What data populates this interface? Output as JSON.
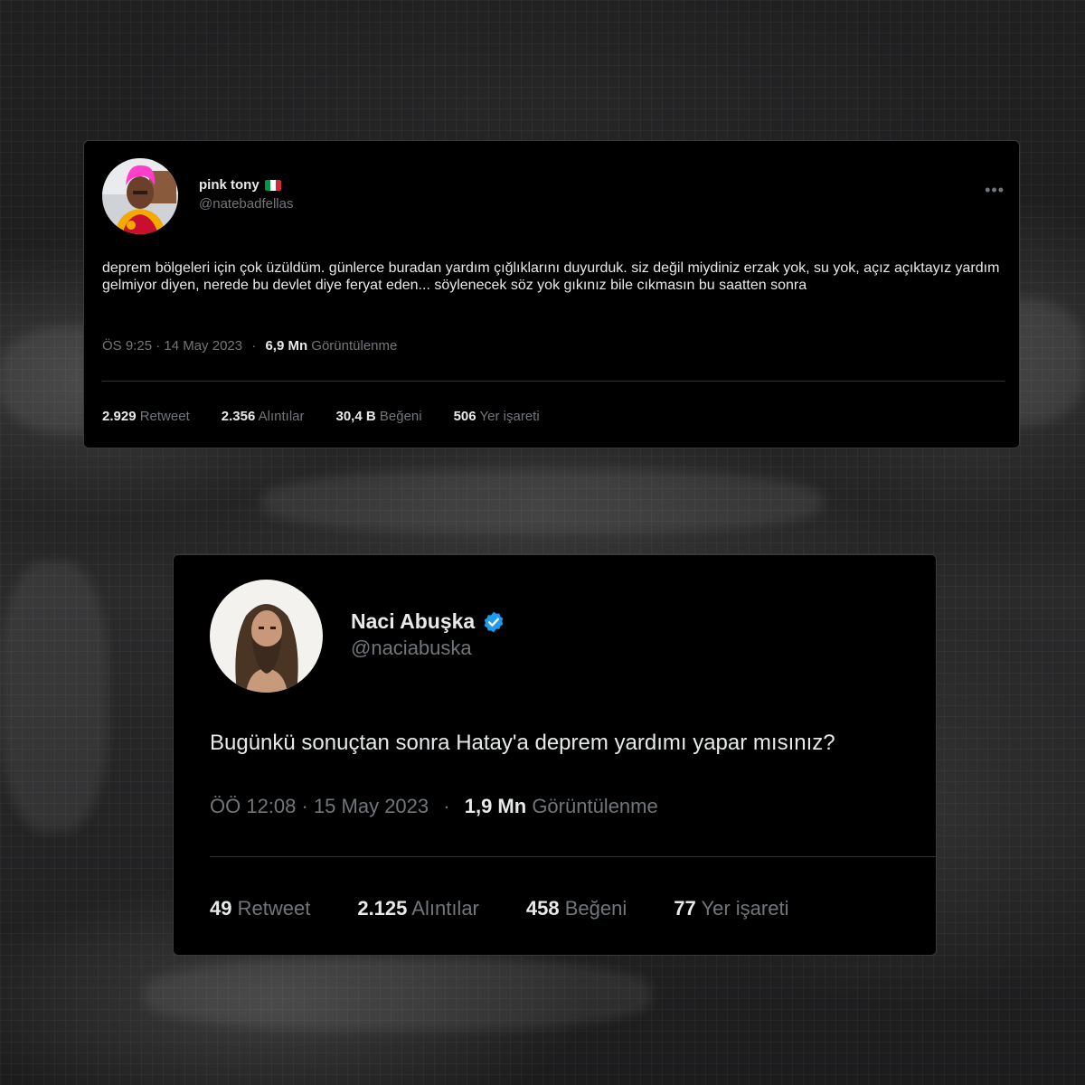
{
  "tweets": [
    {
      "display_name": "pink tony",
      "flag_icon": "italy-flag-icon",
      "handle": "@natebadfellas",
      "more_icon": "more-options-icon",
      "text": "deprem bölgeleri için çok üzüldüm. günlerce buradan yardım çığlıklarını duyurduk. siz değil miydiniz erzak yok, su yok, açız açıktayız yardım gelmiyor diyen, nerede bu devlet diye feryat eden... söylenecek söz yok  gıkınız bile cıkmasın bu saatten sonra",
      "timestamp": "ÖS 9:25 · 14 May 2023",
      "separator": "·",
      "views_count": "6,9 Mn",
      "views_label": "Görüntülenme",
      "stats": [
        {
          "value": "2.929",
          "label": "Retweet"
        },
        {
          "value": "2.356",
          "label": "Alıntılar"
        },
        {
          "value": "30,4 B",
          "label": "Beğeni"
        },
        {
          "value": "506",
          "label": "Yer işareti"
        }
      ]
    },
    {
      "display_name": "Naci Abuşka",
      "verified_icon": "verified-badge-icon",
      "handle": "@naciabuska",
      "text": "Bugünkü sonuçtan sonra Hatay'a deprem yardımı yapar mısınız?",
      "timestamp": "ÖÖ 12:08 · 15 May 2023",
      "separator": "·",
      "views_count": "1,9 Mn",
      "views_label": "Görüntülenme",
      "stats": [
        {
          "value": "49",
          "label": "Retweet"
        },
        {
          "value": "2.125",
          "label": "Alıntılar"
        },
        {
          "value": "458",
          "label": "Beğeni"
        },
        {
          "value": "77",
          "label": "Yer işareti"
        }
      ]
    }
  ],
  "colors": {
    "card_bg": "#000000",
    "primary_text": "#e7e9ea",
    "secondary_text": "#71767b",
    "verified_blue": "#1d9bf0",
    "avatar1_hair": "#ff3fc9",
    "avatar1_shirt": "#f2a900"
  }
}
